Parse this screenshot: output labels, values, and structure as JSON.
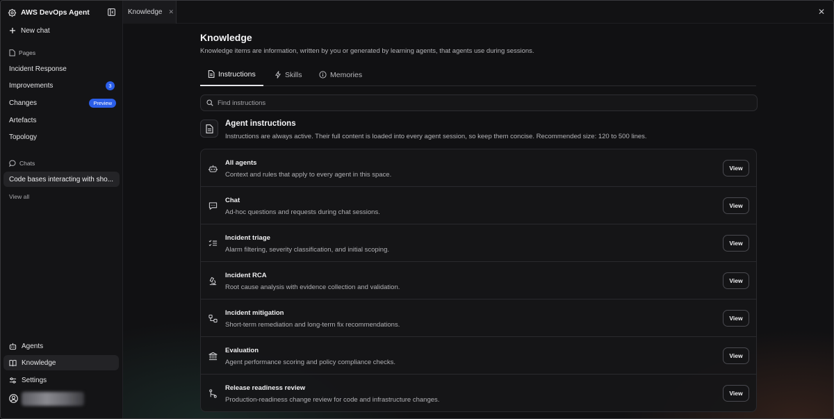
{
  "sidebar": {
    "brand": "AWS DevOps Agent",
    "new_chat": "New chat",
    "pages_label": "Pages",
    "pages": [
      {
        "label": "Incident Response"
      },
      {
        "label": "Improvements",
        "badge": "3"
      },
      {
        "label": "Changes",
        "badge": "Preview"
      },
      {
        "label": "Artefacts"
      },
      {
        "label": "Topology"
      }
    ],
    "chats_label": "Chats",
    "chat_item": "Code bases interacting with sho...",
    "view_all": "View all",
    "bottom": [
      {
        "label": "Agents"
      },
      {
        "label": "Knowledge"
      },
      {
        "label": "Settings"
      }
    ]
  },
  "tabbar": {
    "tab_label": "Knowledge"
  },
  "main": {
    "title": "Knowledge",
    "subtitle": "Knowledge items are information, written by you or generated by learning agents, that agents use during sessions.",
    "tabs": [
      {
        "label": "Instructions",
        "icon": "document-icon"
      },
      {
        "label": "Skills",
        "icon": "lightning-icon"
      },
      {
        "label": "Memories",
        "icon": "info-icon"
      }
    ],
    "search_placeholder": "Find instructions",
    "section": {
      "title": "Agent instructions",
      "description": "Instructions are always active. Their full content is loaded into every agent session, so keep them concise. Recommended size: 120 to 500 lines."
    },
    "view_label": "View",
    "items": [
      {
        "title": "All agents",
        "description": "Context and rules that apply to every agent in this space.",
        "icon": "robot-icon"
      },
      {
        "title": "Chat",
        "description": "Ad-hoc questions and requests during chat sessions.",
        "icon": "chat-bubble-icon"
      },
      {
        "title": "Incident triage",
        "description": "Alarm filtering, severity classification, and initial scoping.",
        "icon": "checklist-icon"
      },
      {
        "title": "Incident RCA",
        "description": "Root cause analysis with evidence collection and validation.",
        "icon": "microscope-icon"
      },
      {
        "title": "Incident mitigation",
        "description": "Short-term remediation and long-term fix recommendations.",
        "icon": "workflow-icon"
      },
      {
        "title": "Evaluation",
        "description": "Agent performance scoring and policy compliance checks.",
        "icon": "building-icon"
      },
      {
        "title": "Release readiness review",
        "description": "Production-readiness change review for code and infrastructure changes.",
        "icon": "git-branch-icon"
      }
    ]
  }
}
